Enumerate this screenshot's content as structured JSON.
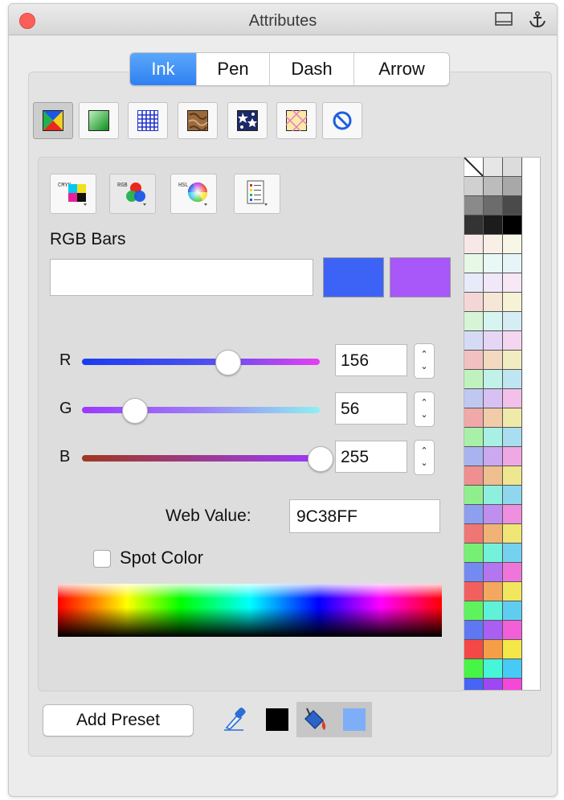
{
  "window": {
    "title": "Attributes"
  },
  "tabs": [
    {
      "label": "Ink",
      "active": true
    },
    {
      "label": "Pen",
      "active": false
    },
    {
      "label": "Dash",
      "active": false
    },
    {
      "label": "Arrow",
      "active": false
    }
  ],
  "fill_types": [
    "color-fill-icon",
    "gradient-fill-icon",
    "pattern-fill-icon",
    "texture-fill-icon",
    "image-fill-icon",
    "hatch-fill-icon",
    "no-fill-icon"
  ],
  "color_modes": [
    {
      "icon": "cmyk-mode-icon",
      "text": "CMYK"
    },
    {
      "icon": "rgb-mode-icon",
      "text": "RGB"
    },
    {
      "icon": "hsl-mode-icon",
      "text": "HSL"
    },
    {
      "icon": "palette-list-icon",
      "text": ""
    }
  ],
  "rgb": {
    "section_label": "RGB Bars",
    "old_color": "#3d63f6",
    "new_color": "#a857f8",
    "r_label": "R",
    "r_value": "156",
    "r_fraction": 0.612,
    "g_label": "G",
    "g_value": "56",
    "g_fraction": 0.22,
    "b_label": "B",
    "b_value": "255",
    "b_fraction": 1.0,
    "web_label": "Web Value:",
    "web_value": "9C38FF",
    "spot_label": "Spot Color",
    "spot_checked": false
  },
  "footer": {
    "add_preset_label": "Add Preset"
  },
  "tools": {
    "fill_well_color": "#000000",
    "bucket_well_color": "#7eaef7"
  }
}
